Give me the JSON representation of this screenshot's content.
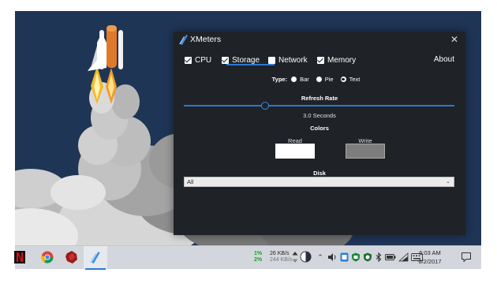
{
  "window": {
    "title": "XMeters",
    "close_glyph": "✕",
    "tabs": [
      {
        "label": "CPU",
        "checked": true
      },
      {
        "label": "Storage",
        "checked": true,
        "selected": true
      },
      {
        "label": "Network",
        "checked": false
      },
      {
        "label": "Memory",
        "checked": true
      }
    ],
    "about_label": "About",
    "type": {
      "label": "Type:",
      "options": [
        {
          "label": "Bar",
          "selected": false
        },
        {
          "label": "Pie",
          "selected": false
        },
        {
          "label": "Text",
          "selected": true
        }
      ]
    },
    "refresh": {
      "title": "Refresh Rate",
      "value_label": "3.0 Seconds",
      "slider_fraction": 0.3
    },
    "colors": {
      "title": "Colors",
      "read_label": "Read",
      "write_label": "Write",
      "read_color": "#ffffff",
      "write_color": "#7d7d7d"
    },
    "disk": {
      "title": "Disk",
      "selected": "All"
    },
    "accent_color": "#2b79d0"
  },
  "taskbar": {
    "apps": [
      {
        "name": "netflix-icon",
        "letter": "N"
      },
      {
        "name": "chrome-icon"
      },
      {
        "name": "red-app-icon"
      },
      {
        "name": "xmeters-icon",
        "active": true
      }
    ],
    "meters": {
      "cpu_pct": "1%",
      "mem_pct": "2%",
      "read_speed": "26 KB/s",
      "write_speed": "244 KB/s"
    },
    "clock": {
      "time": "6:03 AM",
      "date": "6/2/2017"
    }
  }
}
